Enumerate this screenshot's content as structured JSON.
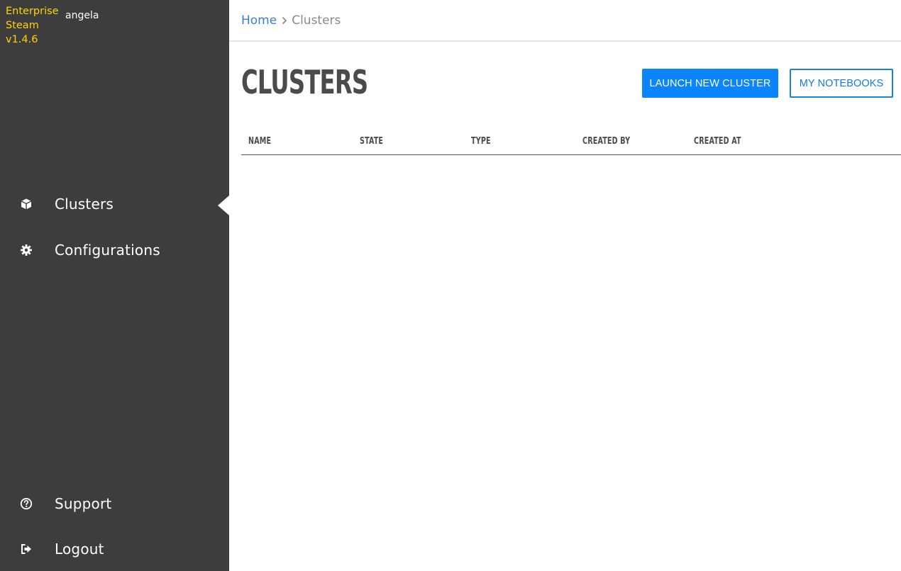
{
  "sidebar": {
    "brand": {
      "line1": "Enterprise",
      "line2": "Steam",
      "version": "v1.4.6"
    },
    "username": "angela",
    "nav": [
      {
        "label": "Clusters",
        "icon": "cube-icon",
        "active": true
      },
      {
        "label": "Configurations",
        "icon": "gear-icon",
        "active": false
      }
    ],
    "footer": [
      {
        "label": "Support",
        "icon": "help-circle-icon"
      },
      {
        "label": "Logout",
        "icon": "logout-icon"
      }
    ]
  },
  "breadcrumb": {
    "home": "Home",
    "current": "Clusters"
  },
  "page": {
    "title": "CLUSTERS",
    "launch_button": "LAUNCH NEW CLUSTER",
    "notebooks_button": "MY NOTEBOOKS"
  },
  "table": {
    "columns": [
      "NAME",
      "STATE",
      "TYPE",
      "CREATED BY",
      "CREATED AT"
    ],
    "rows": []
  },
  "colors": {
    "sidebar_bg": "#3d3d3d",
    "brand": "#ffd400",
    "accent": "#0a84ff",
    "link": "#3a7bd5"
  }
}
